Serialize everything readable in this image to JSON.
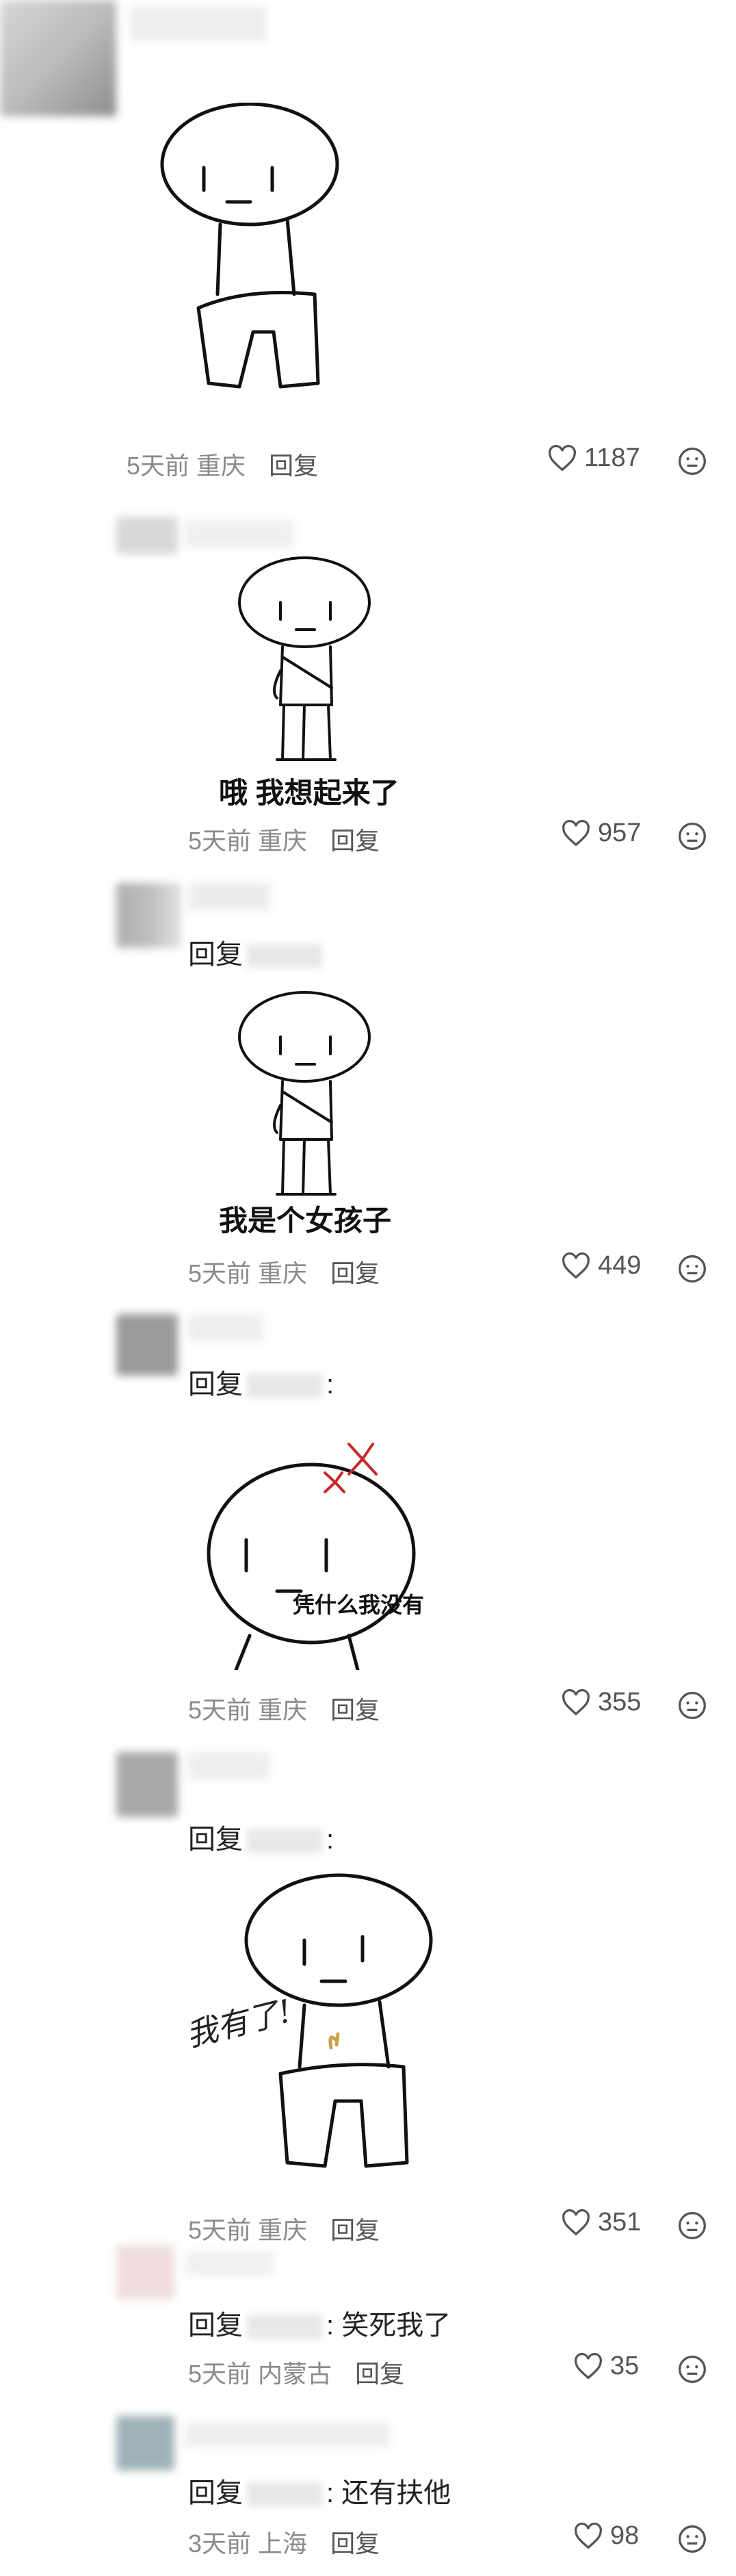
{
  "comments": [
    {
      "time": "5天前",
      "location": "重庆",
      "reply_label": "回复",
      "likes": "1187"
    },
    {
      "caption": "哦 我想起来了",
      "time": "5天前",
      "location": "重庆",
      "reply_label": "回复",
      "likes": "957"
    },
    {
      "reply_prefix": "回复",
      "caption": "我是个女孩子",
      "time": "5天前",
      "location": "重庆",
      "reply_label": "回复",
      "likes": "449"
    },
    {
      "reply_prefix": "回复",
      "caption": "凭什么我没有",
      "time": "5天前",
      "location": "重庆",
      "reply_label": "回复",
      "likes": "355"
    },
    {
      "reply_prefix": "回复",
      "caption": "我有了!",
      "time": "5天前",
      "location": "重庆",
      "reply_label": "回复",
      "likes": "351"
    },
    {
      "reply_prefix": "回复",
      "reply_text": "笑死我了",
      "time": "5天前",
      "location": "内蒙古",
      "reply_label": "回复",
      "likes": "35"
    },
    {
      "reply_prefix": "回复",
      "reply_text": "还有扶他",
      "time": "3天前",
      "location": "上海",
      "reply_label": "回复",
      "likes": "98"
    }
  ],
  "icons": {
    "like": "heart-outline-icon",
    "reaction": "neutral-face-icon"
  },
  "colors": {
    "meta": "#8a8a8a",
    "text": "#222222",
    "avatar_gray": "#a8a8a8"
  }
}
